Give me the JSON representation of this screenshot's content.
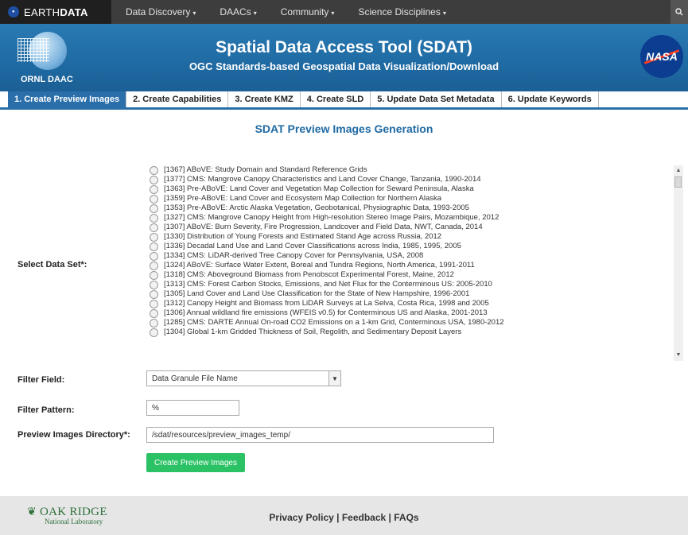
{
  "topbar": {
    "brand_prefix": "EARTH",
    "brand_suffix": "DATA",
    "nav": [
      {
        "label": "Data Discovery"
      },
      {
        "label": "DAACs"
      },
      {
        "label": "Community"
      },
      {
        "label": "Science Disciplines"
      }
    ],
    "caret": "▾",
    "search_icon": "search-icon"
  },
  "header": {
    "org_logo_label": "ORNL DAAC",
    "title": "Spatial Data Access Tool (SDAT)",
    "subtitle": "OGC Standards-based Geospatial Data Visualization/Download",
    "nasa_label": "NASA"
  },
  "tabs": [
    {
      "label": "1. Create Preview Images",
      "active": true
    },
    {
      "label": "2. Create Capabilities",
      "active": false
    },
    {
      "label": "3. Create KMZ",
      "active": false
    },
    {
      "label": "4. Create SLD",
      "active": false
    },
    {
      "label": "5. Update Data Set Metadata",
      "active": false
    },
    {
      "label": "6. Update Keywords",
      "active": false
    }
  ],
  "main": {
    "heading": "SDAT Preview Images Generation",
    "dataset_label": "Select Data Set*:",
    "datasets": [
      "[1367] ABoVE: Study Domain and Standard Reference Grids",
      "[1377] CMS: Mangrove Canopy Characteristics and Land Cover Change, Tanzania, 1990-2014",
      "[1363] Pre-ABoVE: Land Cover and Vegetation Map Collection for Seward Peninsula, Alaska",
      "[1359] Pre-ABoVE: Land Cover and Ecosystem Map Collection for Northern Alaska",
      "[1353] Pre-ABoVE: Arctic Alaska Vegetation, Geobotanical, Physiographic Data, 1993-2005",
      "[1327] CMS: Mangrove Canopy Height from High-resolution Stereo Image Pairs, Mozambique, 2012",
      "[1307] ABoVE: Burn Severity, Fire Progression, Landcover and Field Data, NWT, Canada, 2014",
      "[1330] Distribution of Young Forests and Estimated Stand Age across Russia, 2012",
      "[1336] Decadal Land Use and Land Cover Classifications across India, 1985, 1995, 2005",
      "[1334] CMS: LiDAR-derived Tree Canopy Cover for Pennsylvania, USA, 2008",
      "[1324] ABoVE: Surface Water Extent, Boreal and Tundra Regions, North America, 1991-2011",
      "[1318] CMS: Aboveground Biomass from Penobscot Experimental Forest, Maine, 2012",
      "[1313] CMS: Forest Carbon Stocks, Emissions, and Net Flux for the Conterminous US: 2005-2010",
      "[1305] Land Cover and Land Use Classification for the State of New Hampshire, 1996-2001",
      "[1312] Canopy Height and Biomass from LiDAR Surveys at La Selva, Costa Rica, 1998 and 2005",
      "[1306] Annual wildland fire emissions (WFEIS v0.5) for Conterminous US and Alaska, 2001-2013",
      "[1285] CMS: DARTE Annual On-road CO2 Emissions on a 1-km Grid, Conterminous USA, 1980-2012",
      "[1304] Global 1-km Gridded Thickness of Soil, Regolith, and Sedimentary Deposit Layers"
    ],
    "filter_field_label": "Filter Field:",
    "filter_field_value": "Data Granule File Name",
    "filter_pattern_label": "Filter Pattern:",
    "filter_pattern_value": "%",
    "preview_dir_label": "Preview Images Directory*:",
    "preview_dir_value": "/sdat/resources/preview_images_temp/",
    "create_button": "Create Preview Images"
  },
  "footer": {
    "lab_name": "OAK RIDGE",
    "lab_sub": "National Laboratory",
    "privacy": "Privacy Policy",
    "feedback": "Feedback",
    "faqs": "FAQs",
    "separator": " | "
  },
  "colors": {
    "brand_blue": "#1f6aa3",
    "create_button": "#2bc265",
    "footer_bg": "#e6e6e6"
  }
}
